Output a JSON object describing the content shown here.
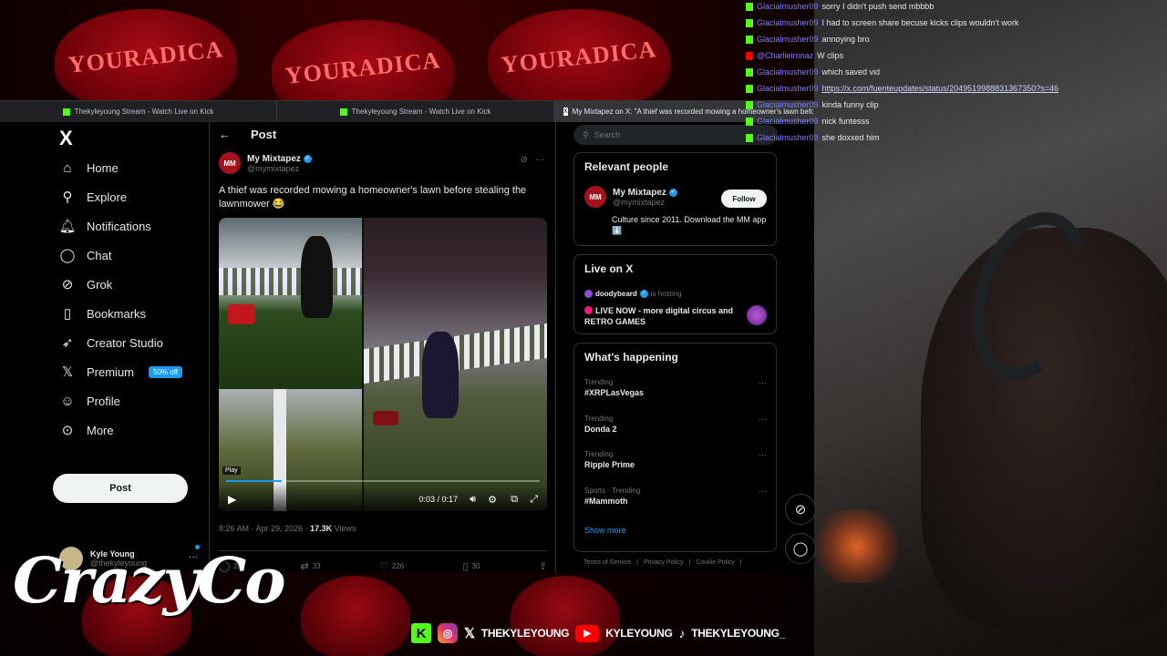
{
  "browser": {
    "tabs": [
      {
        "label": "Thekyleyoung Stream - Watch Live on Kick"
      },
      {
        "label": "Thekyleyoung Stream - Watch Live on Kick"
      },
      {
        "label": "My Mixtapez on X: \"A thief was recorded mowing a homeowner's lawn before st"
      }
    ]
  },
  "sidebar": {
    "logo": "X",
    "items": [
      {
        "label": "Home",
        "icon": "home-icon"
      },
      {
        "label": "Explore",
        "icon": "search-icon"
      },
      {
        "label": "Notifications",
        "icon": "bell-icon"
      },
      {
        "label": "Chat",
        "icon": "chat-icon"
      },
      {
        "label": "Grok",
        "icon": "grok-icon"
      },
      {
        "label": "Bookmarks",
        "icon": "bookmark-icon"
      },
      {
        "label": "Creator Studio",
        "icon": "rocket-icon"
      },
      {
        "label": "Premium",
        "icon": "x-icon",
        "badge": "50% off"
      },
      {
        "label": "Profile",
        "icon": "person-icon"
      },
      {
        "label": "More",
        "icon": "more-circle-icon"
      }
    ],
    "post_button": "Post",
    "account": {
      "name": "Kyle Young",
      "handle": "@thekyleyoung"
    }
  },
  "post": {
    "header_title": "Post",
    "author_name": "My Mixtapez",
    "author_handle": "@mymixtapez",
    "avatar_text": "MM",
    "text": "A thief was recorded mowing a homeowner's lawn before stealing the lawnmower 😂",
    "video": {
      "play_tooltip": "Play",
      "time": "0:03 / 0:17",
      "progress": 0.176
    },
    "timestamp": "8:26 AM · Apr 29, 2026 · ",
    "views_count": "17.3K",
    "views_label": " Views",
    "stats": {
      "replies": "25",
      "reposts": "33",
      "likes": "226",
      "bookmarks": "30"
    }
  },
  "right": {
    "search_placeholder": "Search",
    "relevant_people": {
      "title": "Relevant people",
      "name": "My Mixtapez",
      "handle": "@mymixtapez",
      "follow": "Follow",
      "bio": "Culture since 2011. Download the MM app ⬇️"
    },
    "live": {
      "title": "Live on X",
      "host": "doodybeard",
      "status": "is hosting",
      "stream_title": "LIVE NOW - more digital circus and RETRO GAMES"
    },
    "happening": {
      "title": "What's happening",
      "trends": [
        {
          "context": "Trending",
          "name": "#XRPLasVegas"
        },
        {
          "context": "Trending",
          "name": "Donda 2"
        },
        {
          "context": "Trending",
          "name": "Ripple Prime"
        },
        {
          "context": "Sports · Trending",
          "name": "#Mammoth"
        }
      ],
      "show_more": "Show more"
    },
    "footer": [
      "Terms of Service",
      "|",
      "Privacy Policy",
      "|",
      "Cookie Policy",
      "|"
    ]
  },
  "chat": [
    {
      "user": "Glacialmusher09",
      "msg": "sorry I didn't push send mbbbb",
      "badge": "kick"
    },
    {
      "user": "Glacialmusher09",
      "msg": "I had to screen share becuse kicks clips wouldn't work",
      "badge": "kick"
    },
    {
      "user": "Glacialmusher09",
      "msg": "annoying bro",
      "badge": "kick"
    },
    {
      "user": "@Charlieironaz",
      "msg": "W clips",
      "badge": "yt"
    },
    {
      "user": "Glacialmusher09",
      "msg": "which saved vid",
      "badge": "kick"
    },
    {
      "user": "Glacialmusher09",
      "msg": "https://x.com/fuenteupdates/status/2049519988831367350?s=46",
      "badge": "kick"
    },
    {
      "user": "Glacialmusher09",
      "msg": "kinda funny clip",
      "badge": "kick"
    },
    {
      "user": "Glacialmusher09",
      "msg": "nick funtesss",
      "badge": "kick"
    },
    {
      "user": "Glacialmusher09",
      "msg": "she doxxed him",
      "badge": "kick"
    }
  ],
  "overlay": {
    "brand": "CrazyCo",
    "caps_text": "YOURADICA",
    "socials": {
      "x_handle": "THEKYLEYOUNG",
      "yt_handle": "KYLEYOUNG",
      "tiktok_handle": "THEKYLEYOUNG_"
    }
  },
  "colors": {
    "accent": "#1d9bf0",
    "kick": "#53fc18",
    "background": "#000000"
  }
}
